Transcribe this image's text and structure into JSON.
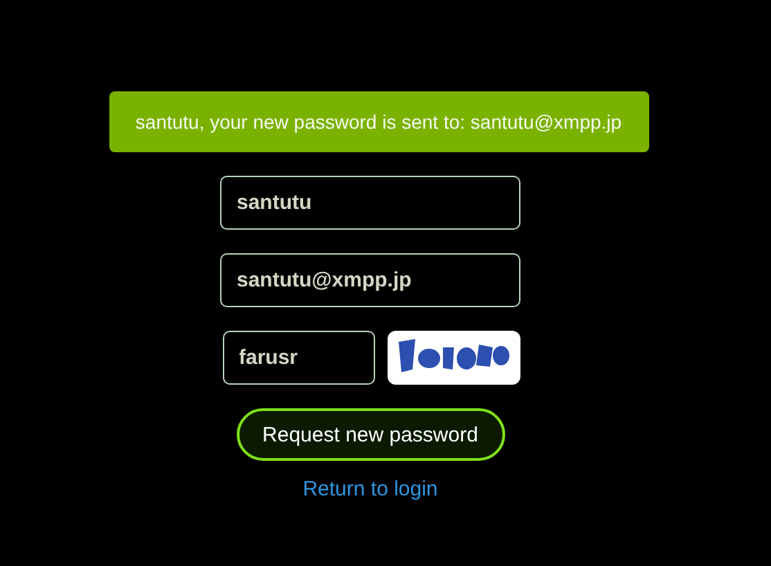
{
  "notice": {
    "text": "santutu, your new password is sent to: santutu@xmpp.jp"
  },
  "fields": [
    {
      "value": "santutu"
    },
    {
      "value": "santutu@xmpp.jp"
    }
  ],
  "captcha": {
    "value": "farusr"
  },
  "submit_button": {
    "label": "Request new password"
  },
  "login_link": {
    "label": "Return to login"
  }
}
